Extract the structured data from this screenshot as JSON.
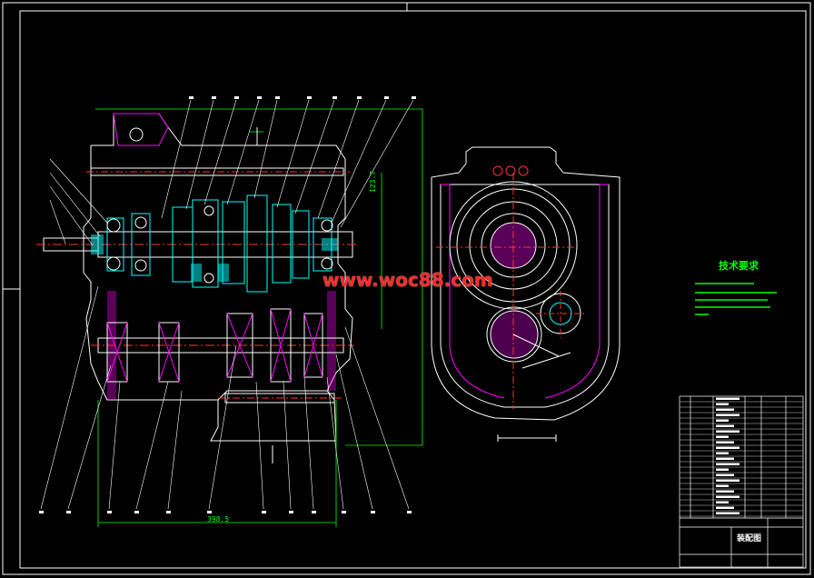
{
  "watermark": "www.woc88.com",
  "technical_requirements": {
    "title": "技术要求",
    "line_count": 5
  },
  "title_block": {
    "drawing_title": "装配图"
  },
  "dimensions": {
    "overall_length": "398.5",
    "upper_height": "123.7"
  },
  "colors": {
    "background": "#000000",
    "outline": "#ffffff",
    "dimension": "#00ff00",
    "centerline": "#ff3333",
    "hatch": "#ff00ff",
    "part": "#00ffff",
    "watermark": "#ff2a2a"
  }
}
